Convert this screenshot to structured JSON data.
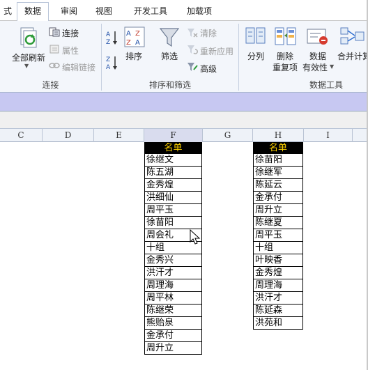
{
  "ribbon": {
    "tabs": [
      {
        "label": "式",
        "active": false
      },
      {
        "label": "数据",
        "active": true
      },
      {
        "label": "审阅",
        "active": false
      },
      {
        "label": "视图",
        "active": false
      },
      {
        "label": "开发工具",
        "active": false
      },
      {
        "label": "加载项",
        "active": false
      }
    ],
    "connections": {
      "refresh_all": "全部刷新",
      "connections": "连接",
      "properties": "属性",
      "edit_links": "编辑链接",
      "group_label": "连接"
    },
    "sort_filter": {
      "sort": "排序",
      "filter": "筛选",
      "clear": "清除",
      "reapply": "重新应用",
      "advanced": "高级",
      "group_label": "排序和筛选"
    },
    "data_tools": {
      "text_to_columns": "分列",
      "remove_duplicates_line1": "删除",
      "remove_duplicates_line2": "重复项",
      "validation_line1": "数据",
      "validation_line2": "有效性",
      "consolidate": "合并计算",
      "group_label": "数据工具"
    }
  },
  "sheet": {
    "columns": [
      "C",
      "D",
      "E",
      "F",
      "G",
      "H",
      "I"
    ],
    "list_f": {
      "header": "名单",
      "names": [
        "徐继文",
        "陈五湖",
        "金秀煌",
        "洪细仙",
        "周平玉",
        "徐苗阳",
        "周会礼",
        "十组",
        "金秀兴",
        "洪汗才",
        "周理海",
        "周平林",
        "陈继荣",
        "熊贻泉",
        "金承付",
        "周升立"
      ]
    },
    "list_h": {
      "header": "名单",
      "names": [
        "徐苗阳",
        "徐继军",
        "陈延云",
        "金承付",
        "周升立",
        "陈继夏",
        "周平玉",
        "十组",
        "叶映香",
        "金秀煌",
        "周理海",
        "洪汗才",
        "陈延森",
        "洪苑和"
      ]
    }
  },
  "colors": {
    "header_bg": "#000000",
    "header_text": "#ffd200",
    "ribbon_bg": "#f3f6fb",
    "band": "#c7c8f2"
  }
}
